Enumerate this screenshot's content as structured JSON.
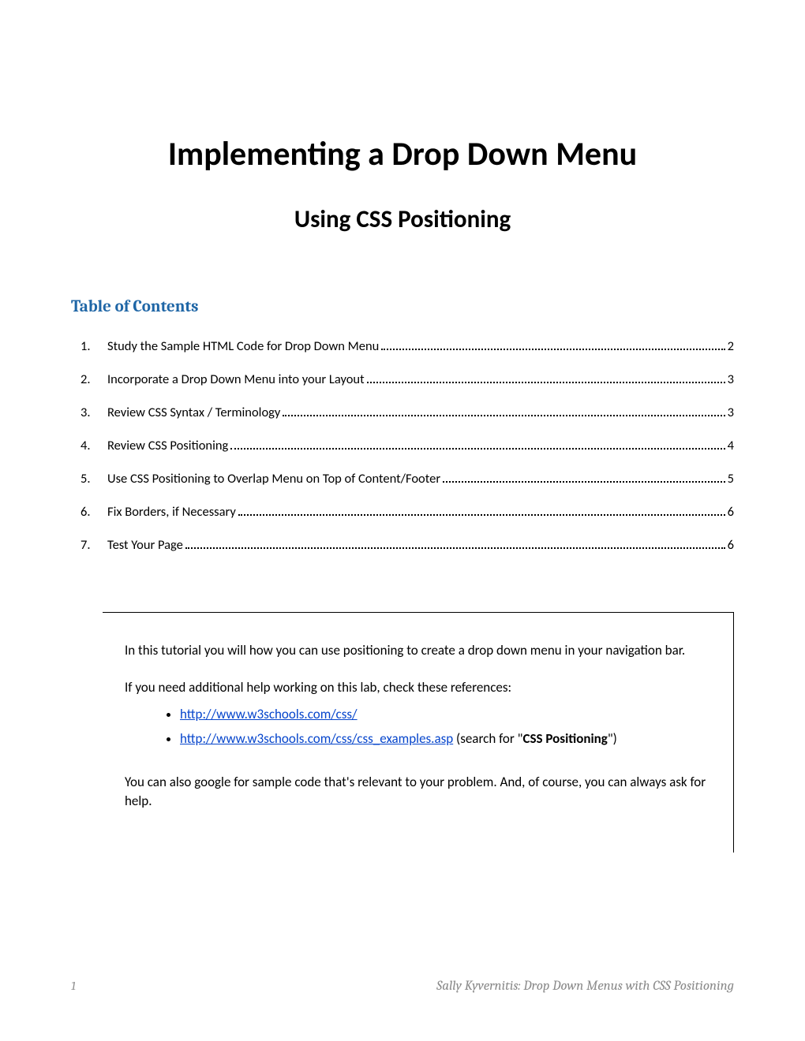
{
  "title": "Implementing a Drop Down Menu",
  "subtitle": "Using CSS Positioning",
  "toc_heading": "Table of Contents",
  "toc": [
    {
      "num": "1.",
      "label": "Study the Sample HTML Code for Drop Down Menu",
      "page": "2"
    },
    {
      "num": "2.",
      "label": "Incorporate a Drop Down Menu into your Layout",
      "page": "3"
    },
    {
      "num": "3.",
      "label": "Review CSS Syntax / Terminology",
      "page": "3"
    },
    {
      "num": "4.",
      "label": "Review CSS Positioning",
      "page": "4"
    },
    {
      "num": "5.",
      "label": "Use CSS Positioning to Overlap Menu on Top of Content/Footer",
      "page": "5"
    },
    {
      "num": "6.",
      "label": "Fix Borders, if Necessary",
      "page": "6"
    },
    {
      "num": "7.",
      "label": "Test Your Page",
      "page": "6"
    }
  ],
  "box": {
    "intro": "In this tutorial you will how you can use positioning to create a drop down menu in your navigation bar.",
    "help_lead": "If you need additional help working on this lab, check these references:",
    "links": [
      {
        "text": "http://www.w3schools.com/css/",
        "suffix": ""
      },
      {
        "text": "http://www.w3schools.com/css/css_examples.asp",
        "suffix": " (search for \"",
        "bold": "CSS Positioning",
        "suffix2": "\")"
      }
    ],
    "outro": "You can also google for sample code that's relevant to your problem. And, of course, you can always ask for help."
  },
  "footer": {
    "pagenum": "1",
    "text": "Sally Kyvernitis:  Drop Down Menus with CSS Positioning"
  }
}
